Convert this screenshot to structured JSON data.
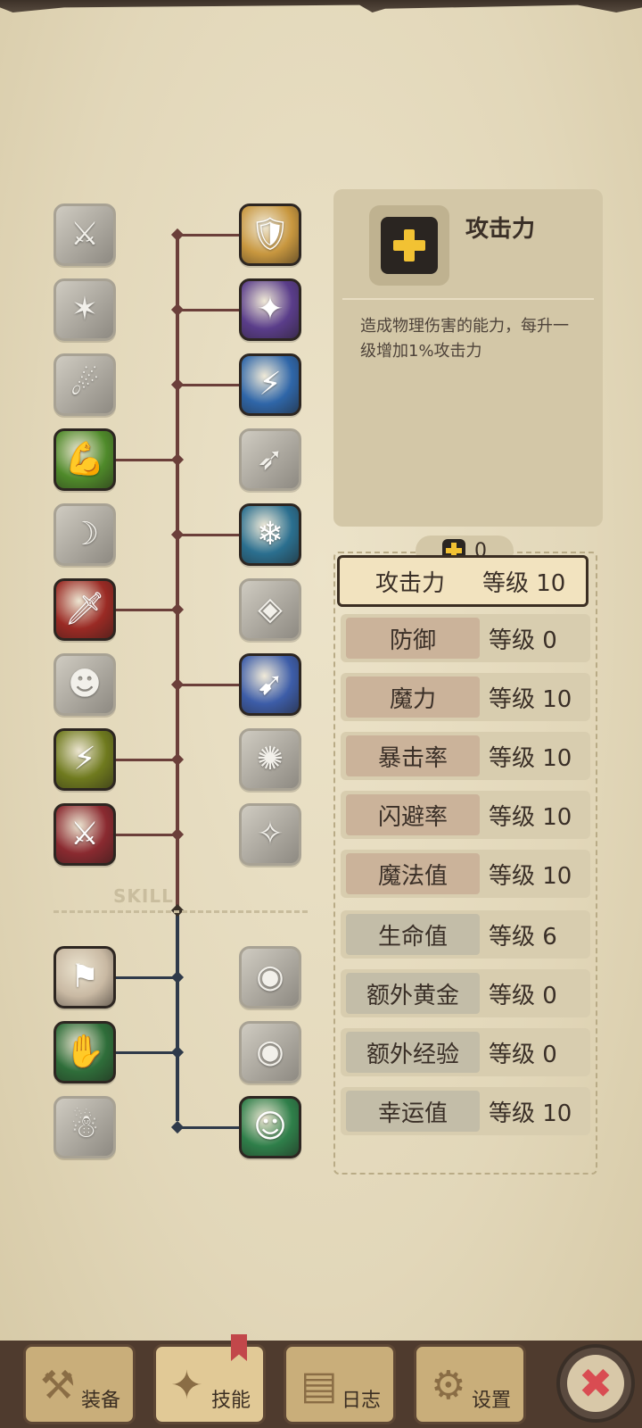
{
  "detail": {
    "title": "攻击力",
    "icon": "plus-icon",
    "description": "造成物理伤害的能力，每升一级增加1%攻击力"
  },
  "skill_label": "SKILL",
  "points": {
    "icon": "plus-icon",
    "value": "0"
  },
  "stats": [
    {
      "label": "攻击力",
      "level": "等级 10",
      "selected": true,
      "group": "combat"
    },
    {
      "label": "防御",
      "level": "等级 0",
      "group": "combat"
    },
    {
      "label": "魔力",
      "level": "等级 10",
      "group": "combat"
    },
    {
      "label": "暴击率",
      "level": "等级 10",
      "group": "combat"
    },
    {
      "label": "闪避率",
      "level": "等级 10",
      "group": "combat"
    },
    {
      "label": "魔法值",
      "level": "等级 10",
      "group": "combat"
    },
    {
      "label": "生命值",
      "level": "等级 6",
      "group": "utility"
    },
    {
      "label": "额外黄金",
      "level": "等级 0",
      "group": "utility"
    },
    {
      "label": "额外经验",
      "level": "等级 0",
      "group": "utility"
    },
    {
      "label": "幸运值",
      "level": "等级 10",
      "group": "utility"
    }
  ],
  "nav": [
    {
      "label": "装备",
      "icon": "axe-icon"
    },
    {
      "label": "技能",
      "icon": "skill-sigil-icon",
      "active": true
    },
    {
      "label": "日志",
      "icon": "journal-icon"
    },
    {
      "label": "设置",
      "icon": "gear-icon"
    }
  ],
  "close": {
    "icon": "close-icon",
    "glyph": "✖"
  },
  "colors": {
    "tree_upper": "#6b3f3a",
    "tree_lower": "#2f3a4a",
    "plus": "#f2c233",
    "selected_border": "#3b2e22",
    "combat_label_bg": "#cbb39a",
    "utility_label_bg": "#c3bda8"
  },
  "skills": {
    "left": [
      {
        "name": "blade-slash-icon",
        "unlocked": false,
        "glyph": "⚔"
      },
      {
        "name": "kick-strike-icon",
        "unlocked": false,
        "glyph": "✶"
      },
      {
        "name": "spin-shout-icon",
        "unlocked": false,
        "glyph": "☄"
      },
      {
        "name": "muscle-arm-icon",
        "unlocked": true,
        "glyph": "💪",
        "bg": "#4f8a2a"
      },
      {
        "name": "shadow-dash-icon",
        "unlocked": false,
        "glyph": "☽"
      },
      {
        "name": "dagger-icon",
        "unlocked": true,
        "glyph": "🗡",
        "bg": "#9a2a24"
      },
      {
        "name": "shadow-strike-icon",
        "unlocked": false,
        "glyph": "☻"
      },
      {
        "name": "golden-fury-icon",
        "unlocked": true,
        "glyph": "⚡",
        "bg": "#6f7a1e"
      },
      {
        "name": "greatsword-icon",
        "unlocked": true,
        "glyph": "⚔",
        "bg": "#8a2a30"
      },
      {
        "name": "red-chest-icon",
        "unlocked": true,
        "glyph": "⚑",
        "bg": "#c9b9a3"
      },
      {
        "name": "green-chest-icon",
        "unlocked": true,
        "glyph": "✋",
        "bg": "#2f6e3a"
      },
      {
        "name": "ghost-spirit-icon",
        "unlocked": false,
        "glyph": "☃"
      }
    ],
    "right": [
      {
        "name": "holy-shield-icon",
        "unlocked": true,
        "glyph": "🛡",
        "bg": "#c8973f"
      },
      {
        "name": "purple-blast-icon",
        "unlocked": true,
        "glyph": "✦",
        "bg": "#5a3d8a"
      },
      {
        "name": "lightning-icon",
        "unlocked": true,
        "glyph": "⚡",
        "bg": "#2f66a8"
      },
      {
        "name": "dash-runner-icon",
        "unlocked": false,
        "glyph": "➶"
      },
      {
        "name": "frost-figure-icon",
        "unlocked": true,
        "glyph": "❄",
        "bg": "#2b6f8f"
      },
      {
        "name": "stone-crack-icon",
        "unlocked": false,
        "glyph": "◈"
      },
      {
        "name": "wind-blade-icon",
        "unlocked": true,
        "glyph": "➹",
        "bg": "#3d5da8"
      },
      {
        "name": "explosion-icon",
        "unlocked": false,
        "glyph": "✺"
      },
      {
        "name": "sparkle-bomb-icon",
        "unlocked": false,
        "glyph": "✧"
      },
      {
        "name": "eye-chest-icon",
        "unlocked": false,
        "glyph": "◉"
      },
      {
        "name": "eye-treasure-icon",
        "unlocked": false,
        "glyph": "◉"
      },
      {
        "name": "green-spirit-icon",
        "unlocked": true,
        "glyph": "☺",
        "bg": "#2f7f4a"
      }
    ]
  }
}
